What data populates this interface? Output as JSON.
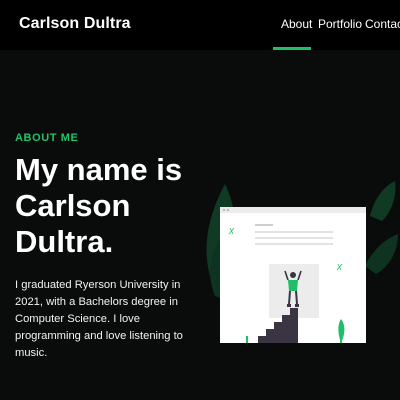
{
  "brand": {
    "name": "Carlson Dultra"
  },
  "nav": {
    "items": [
      {
        "label": "About",
        "active": true
      },
      {
        "label": "Portfolio",
        "active": false
      },
      {
        "label": "Contact",
        "active": false
      }
    ]
  },
  "hero": {
    "eyebrow": "ABOUT ME",
    "headline": "My name is Carlson Dultra.",
    "bio": "I graduated Ryerson University in 2021, with a Bachelors degree in Computer Science. I love programming and love listening to music."
  },
  "illustration": {
    "icon": "person-on-stairs-illustration"
  },
  "colors": {
    "accent": "#1fbf6a",
    "background": "#0a0c0b",
    "navbar": "#000000",
    "leaf": "#103a24"
  }
}
